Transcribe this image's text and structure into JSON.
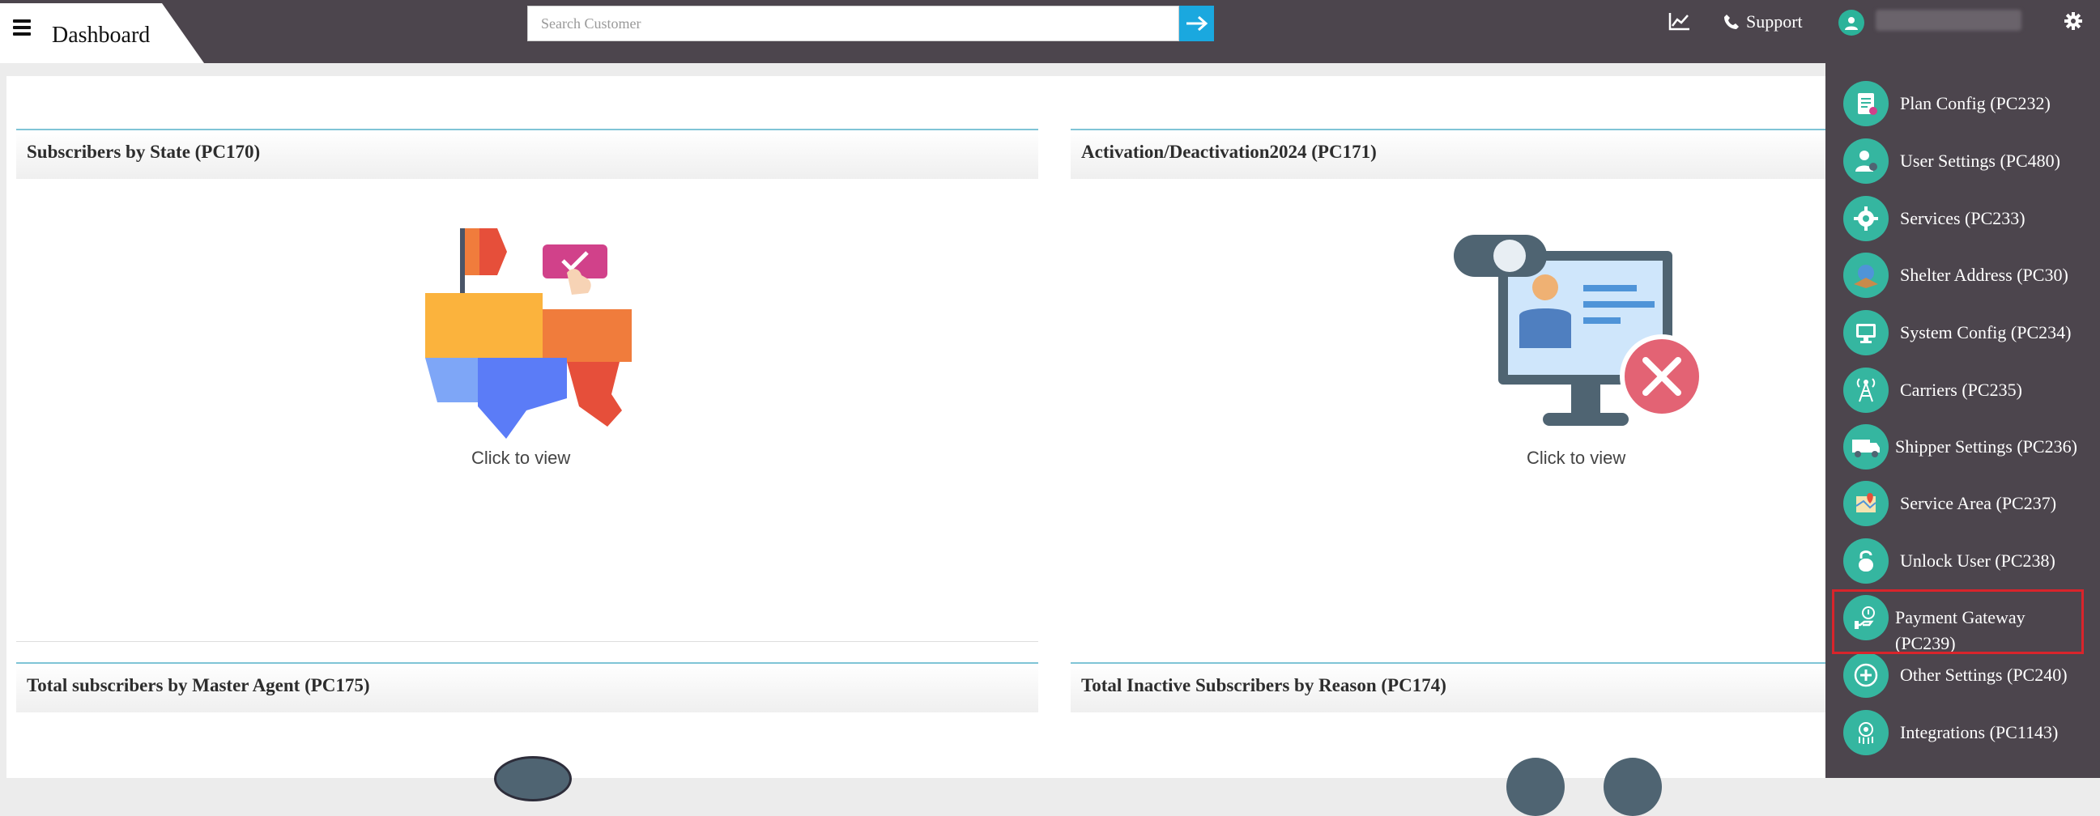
{
  "header": {
    "title": "Dashboard",
    "search_placeholder": "Search Customer",
    "support_label": "Support"
  },
  "panels": [
    {
      "title": "Subscribers by State (PC170)",
      "cta": "Click to view"
    },
    {
      "title": "Activation/Deactivation2024 (PC171)",
      "cta": "Click to view"
    },
    {
      "title": "Total subscribers by Master Agent (PC175)"
    },
    {
      "title": "Total Inactive Subscribers by Reason (PC174)"
    }
  ],
  "menu": {
    "items": [
      {
        "label": "Plan Config (PC232)",
        "icon": "plan-config-icon"
      },
      {
        "label": "User Settings (PC480)",
        "icon": "user-settings-icon"
      },
      {
        "label": "Services (PC233)",
        "icon": "services-icon"
      },
      {
        "label": "Shelter Address (PC30)",
        "icon": "shelter-address-icon"
      },
      {
        "label": "System Config (PC234)",
        "icon": "system-config-icon"
      },
      {
        "label": "Carriers (PC235)",
        "icon": "carriers-icon"
      },
      {
        "label": "Shipper Settings (PC236)",
        "icon": "shipper-settings-icon"
      },
      {
        "label": "Service Area (PC237)",
        "icon": "service-area-icon"
      },
      {
        "label": "Unlock User (PC238)",
        "icon": "unlock-user-icon"
      },
      {
        "label": "Payment Gateway (PC239)",
        "icon": "payment-gateway-icon"
      },
      {
        "label": "Other Settings (PC240)",
        "icon": "other-settings-icon"
      },
      {
        "label": "Integrations (PC1143)",
        "icon": "integrations-icon"
      }
    ]
  },
  "colors": {
    "topbar": "#4c454d",
    "accent": "#1aa8df",
    "menu_icon": "#35b6a0",
    "highlight": "#d9242b"
  }
}
